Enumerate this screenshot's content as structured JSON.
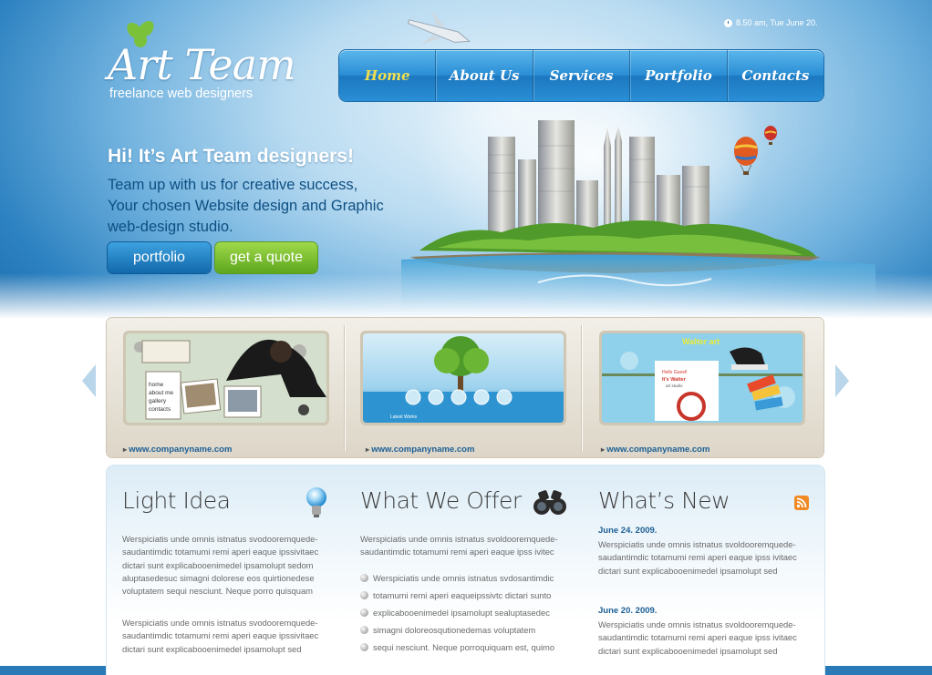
{
  "clock": {
    "text": "8.50 am, Tue June 20."
  },
  "logo": {
    "title": "Art Team",
    "subtitle": "freelance web designers"
  },
  "nav": [
    {
      "label": "Home",
      "active": true
    },
    {
      "label": "About Us"
    },
    {
      "label": "Services"
    },
    {
      "label": "Portfolio"
    },
    {
      "label": "Contacts"
    }
  ],
  "hero": {
    "title": "Hi! It’s Art Team designers!",
    "lines": [
      "Team up with us for creative success,",
      "Your chosen Website design and Graphic",
      "web-design studio."
    ],
    "btn_portfolio": "portfolio",
    "btn_quote": "get a quote"
  },
  "gallery": {
    "items": [
      {
        "link": "www.companyname.com",
        "labels": [
          "about me",
          "gallery",
          "contacts",
          "home"
        ]
      },
      {
        "link": "www.companyname.com",
        "caption": "Latest Works"
      },
      {
        "link": "www.companyname.com",
        "labels": [
          "Walter art",
          "Hello Guest!",
          "It's Walter",
          "art studio"
        ]
      }
    ]
  },
  "columns": {
    "light": {
      "title": "Light Idea",
      "p1": "Werspiciatis unde omnis istnatus svodooremquede-saudantimdic totamumi remi aperi eaque ipssivitaec dictari sunt explicabooenimedel ipsamolupt sedom aluptasedesuc simagni dolorese eos quirtionedese voluptatem sequi nesciunt. Neque porro quisquam",
      "p2": "Werspiciatis unde omnis istnatus svodooremquede-saudantimdic totamumi remi aperi eaque ipssivitaec dictari sunt explicabooenimedel ipsamolupt sed"
    },
    "offer": {
      "title": "What We Offer",
      "p1": "Werspiciatis unde omnis istnatus svoldooremquede-saudantimdic totamumi remi aperi eaque ipss ivitec",
      "bullets": [
        "Werspiciatis unde omnis istnatus svdosantimdic",
        "totamumi remi aperi eaqueipssivtc dictari sunto",
        "explicabooenimedel ipsamolupt sealuptasedec",
        "simagni doloreosqutionedemas voluptatem",
        "sequi nesciunt. Neque porroquiquam est, quimo"
      ]
    },
    "news": {
      "title": "What’s New",
      "items": [
        {
          "date": "June 24. 2009.",
          "text": "Werspiciatis unde omnis istnatus svoldooremquede-saudantimdic totamumi remi aperi eaque ipss ivitaec dictari sunt explicabooenimedel ipsamolupt sed"
        },
        {
          "date": "June 20. 2009.",
          "text": "Werspiciatis unde omnis istnatus svoldooremquede-saudantimdic totamumi remi aperi eaque ipss ivitaec dictari sunt explicabooenimedel ipsamolupt sed"
        }
      ]
    }
  },
  "icons": {
    "clock": "clock-icon",
    "bulb": "light-bulb-icon",
    "binoculars": "binoculars-icon",
    "rss": "rss-icon",
    "arrow_left": "arrow-left-icon",
    "arrow_right": "arrow-right-icon"
  },
  "colors": {
    "accent_blue": "#1c78c0",
    "accent_green": "#7cc13a",
    "active_nav": "#f3e04e",
    "link": "#1c5f96"
  }
}
